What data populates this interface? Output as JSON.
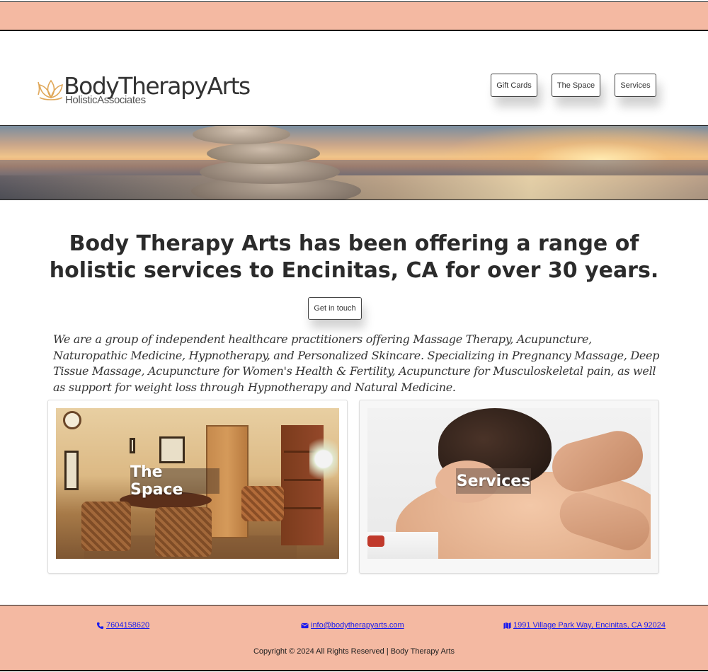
{
  "header": {
    "logo_title": "BodyTherapyArts",
    "logo_subtitle": "HolisticAssociates",
    "logo_icon": "lotus-icon",
    "nav": [
      {
        "label": "Gift Cards"
      },
      {
        "label": "The Space"
      },
      {
        "label": "Services"
      }
    ]
  },
  "banner": {
    "image": "stacked-stones-sunset-image"
  },
  "main": {
    "headline": "Body Therapy Arts has been offering a range of holistic services to Encinitas, CA for over 30 years.",
    "cta_label": "Get in touch",
    "intro": "We are a group of independent healthcare practitioners offering Massage Therapy, Acupuncture, Naturopathic Medicine, Hypnotherapy, and Personalized Skincare. Specializing in Pregnancy Massage, Deep Tissue Massage, Acupuncture for Women's Health & Fertility, Acupuncture for Musculoskeletal pain, as well as support for weight loss through Hypnotherapy and Natural Medicine.",
    "cards": [
      {
        "label": "The Space",
        "image": "treatment-room-image"
      },
      {
        "label": "Services",
        "image": "massage-image"
      }
    ]
  },
  "footer": {
    "phone": "7604158620",
    "phone_icon": "phone-icon",
    "email": "info@bodytherapyarts.com",
    "email_icon": "envelope-icon",
    "address": "1991 Village Park Way, Encinitas, CA 92024",
    "address_icon": "map-icon",
    "copyright": "Copyright © 2024 All Rights Reserved | Body Therapy Arts"
  },
  "colors": {
    "accent_bar": "#f4b9a2",
    "link": "#1a1aee",
    "logo_icon": "#e0a85a"
  }
}
